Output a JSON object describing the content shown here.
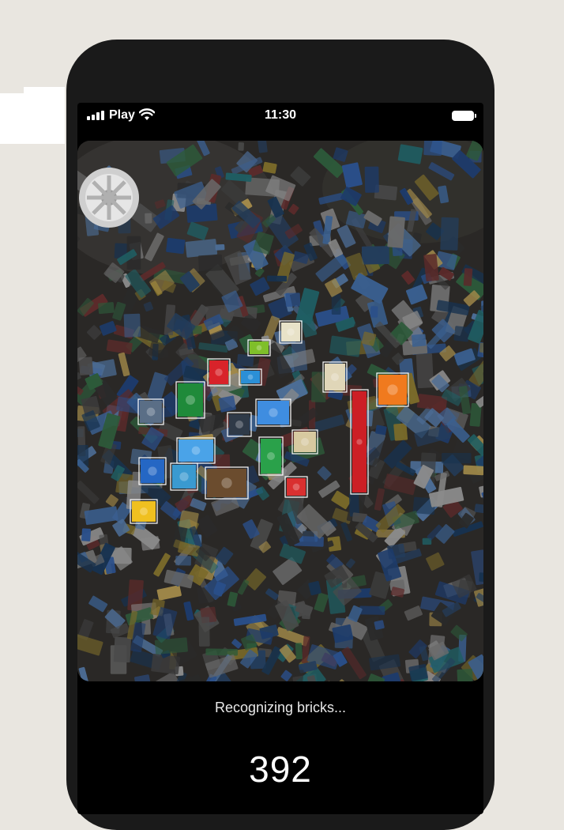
{
  "status_bar": {
    "carrier": "Play",
    "time": "11:30",
    "signal_icon": "cellular-signal-icon",
    "wifi_icon": "wifi-icon",
    "battery_icon": "battery-icon"
  },
  "scan": {
    "status_text": "Recognizing bricks...",
    "brick_count": "392"
  },
  "detections": [
    {
      "color": "#7fbf2a"
    },
    {
      "color": "#e8e2c8"
    },
    {
      "color": "#d8232a"
    },
    {
      "color": "#2b8fd6"
    },
    {
      "color": "#1f8a3a"
    },
    {
      "color": "#e0d6b8"
    },
    {
      "color": "#f07a1e"
    },
    {
      "color": "#5a6e86"
    },
    {
      "color": "#2f3a48"
    },
    {
      "color": "#3f8de0"
    },
    {
      "color": "#cc1f25"
    },
    {
      "color": "#2aa14a"
    },
    {
      "color": "#d7c9a0"
    },
    {
      "color": "#4aa3e8"
    },
    {
      "color": "#2567c4"
    },
    {
      "color": "#3a9ad0"
    },
    {
      "color": "#6b4c2e"
    },
    {
      "color": "#d93030"
    },
    {
      "color": "#f0c020"
    }
  ]
}
